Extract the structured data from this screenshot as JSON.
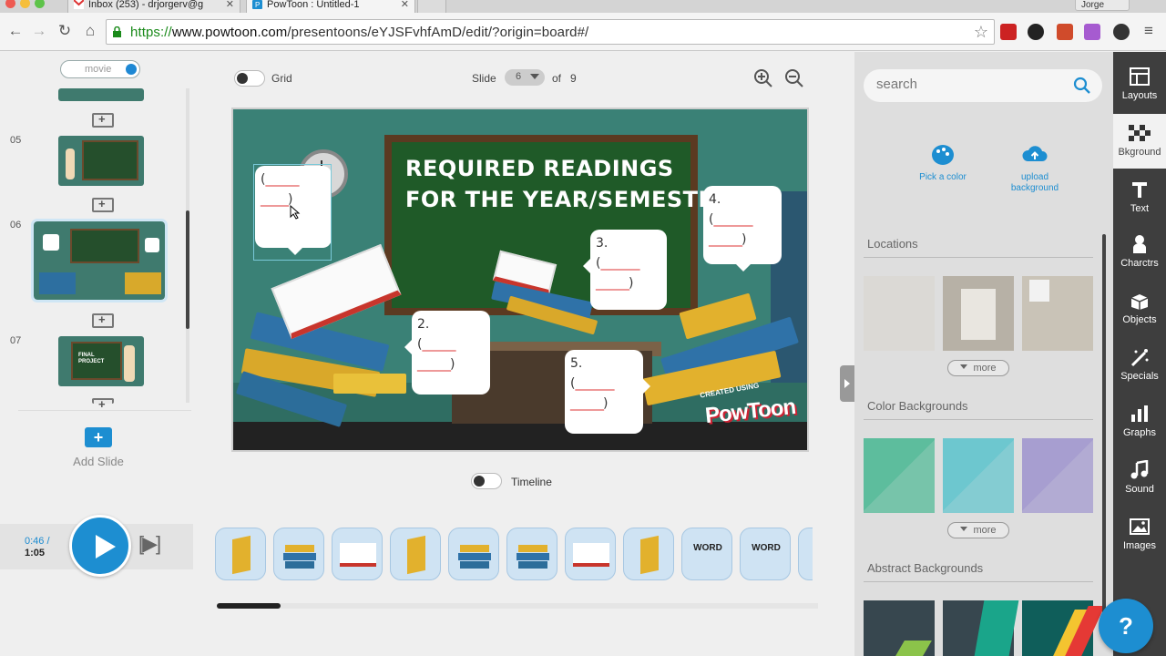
{
  "browser": {
    "tabs": [
      {
        "title": "Inbox (253) - drjorgerv@g"
      },
      {
        "title": "PowToon : Untitled-1"
      }
    ],
    "user": "Jorge",
    "url_scheme": "https://",
    "url_domain": "www.powtoon.com",
    "url_path": "/presentoons/eYJSFvhfAmD/edit/?origin=board#/"
  },
  "left": {
    "movie_label": "movie",
    "slides": [
      {
        "num": "05"
      },
      {
        "num": "06"
      },
      {
        "num": "07"
      }
    ],
    "thumb_texts": {
      "s5": "",
      "s7": "FINAL PROJECT"
    },
    "add_slide_label": "Add Slide",
    "time_current": "0:46 /",
    "time_total": "1:05"
  },
  "editor": {
    "grid_label": "Grid",
    "slide_label": "Slide",
    "slide_current": "6",
    "slide_of": "of",
    "slide_total": "9",
    "timeline_label": "Timeline",
    "canvas": {
      "title_line1": "REQUIRED READINGS",
      "title_line2": "FOR THE YEAR/SEMESTER",
      "bubbles": [
        {
          "num": "",
          "paren_open": "(",
          "blank1": "______",
          "blank2": "_____",
          "paren_close": ")"
        },
        {
          "num": "2.",
          "paren_open": "(",
          "blank1": "______",
          "blank2": "______",
          "paren_close": ")"
        },
        {
          "num": "3.",
          "paren_open": "(",
          "blank1": "_______",
          "blank2": "______",
          "paren_close": ")"
        },
        {
          "num": "4.",
          "paren_open": "(",
          "blank1": "_______",
          "blank2": "______",
          "paren_close": ")"
        },
        {
          "num": "5.",
          "paren_open": "(",
          "blank1": "_______",
          "blank2": "______",
          "paren_close": ")"
        }
      ],
      "watermark_small": "CREATED USING",
      "watermark_big": "PowToon"
    },
    "drawer_items": [
      {
        "kind": "yellow-book",
        "label": ""
      },
      {
        "kind": "book-stack",
        "label": ""
      },
      {
        "kind": "open-book",
        "label": ""
      },
      {
        "kind": "yellow-book",
        "label": ""
      },
      {
        "kind": "book-stack",
        "label": ""
      },
      {
        "kind": "book-stack",
        "label": ""
      },
      {
        "kind": "open-book",
        "label": ""
      },
      {
        "kind": "yellow-book",
        "label": ""
      },
      {
        "kind": "word",
        "label": "WORD"
      },
      {
        "kind": "word",
        "label": "WORD"
      }
    ]
  },
  "library": {
    "search_placeholder": "search",
    "pick_color": "Pick a color",
    "upload_line1": "upload",
    "upload_line2": "background",
    "sections": {
      "locations": "Locations",
      "color_backgrounds": "Color Backgrounds",
      "abstract_backgrounds": "Abstract Backgrounds"
    },
    "more_label": "more",
    "color_tiles": [
      "#5dbd9d",
      "#6dc7cf",
      "#a79ed0"
    ]
  },
  "categories": [
    {
      "label": "Layouts",
      "icon": "layout-icon"
    },
    {
      "label": "Bkground",
      "icon": "background-icon"
    },
    {
      "label": "Text",
      "icon": "text-icon"
    },
    {
      "label": "Charctrs",
      "icon": "character-icon"
    },
    {
      "label": "Objects",
      "icon": "objects-icon"
    },
    {
      "label": "Specials",
      "icon": "specials-icon"
    },
    {
      "label": "Graphs",
      "icon": "graphs-icon"
    },
    {
      "label": "Sound",
      "icon": "sound-icon"
    },
    {
      "label": "Images",
      "icon": "images-icon"
    }
  ],
  "help_label": "?"
}
